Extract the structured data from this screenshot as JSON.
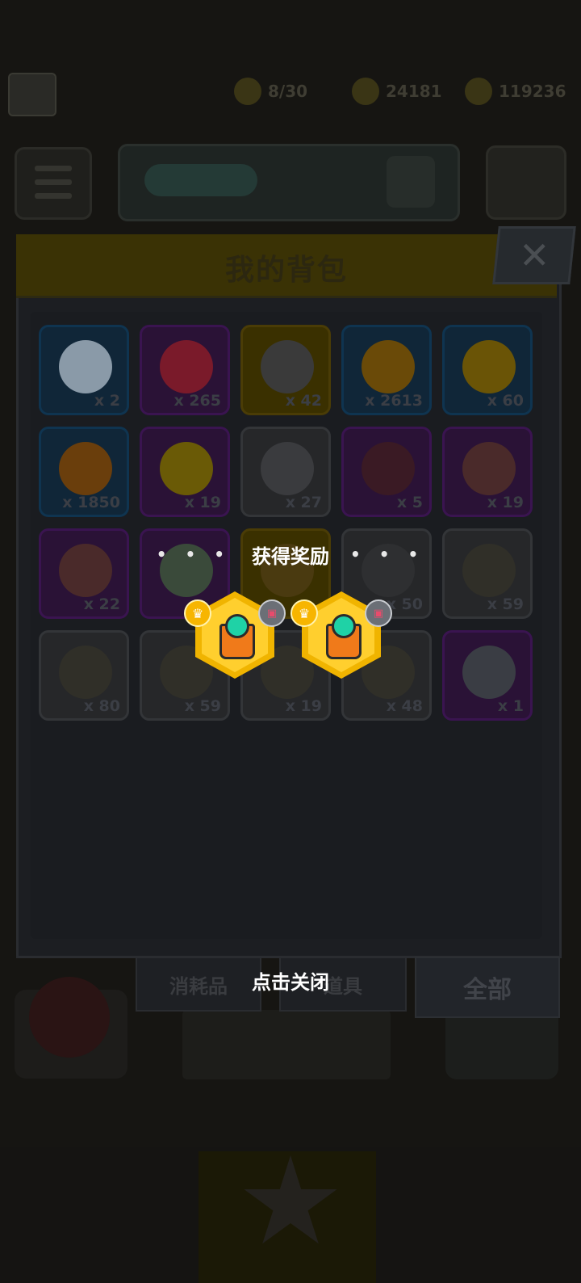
{
  "background": {
    "resources": [
      "8/30",
      "24181",
      "119236"
    ]
  },
  "backpack": {
    "title": "我的背包",
    "close_symbol": "✕",
    "items": [
      {
        "count": "x 2",
        "style": "blue",
        "icon": "key-icon",
        "color": "#8a9aa8"
      },
      {
        "count": "x 265",
        "style": "purple",
        "icon": "heart-coin-icon",
        "color": "#7a1a2a"
      },
      {
        "count": "x 42",
        "style": "gold",
        "icon": "square-key-icon",
        "color": "#3a3a3a"
      },
      {
        "count": "x 2613",
        "style": "blue",
        "icon": "flame-drop-icon",
        "color": "#6a4a08"
      },
      {
        "count": "x 60",
        "style": "blue",
        "icon": "gold-coin-icon",
        "color": "#6a5406"
      },
      {
        "count": "x 1850",
        "style": "blue",
        "icon": "lion-badge-icon",
        "color": "#6a3e0c"
      },
      {
        "count": "x 19",
        "style": "purple",
        "icon": "ticket-icon",
        "color": "#6a5a06"
      },
      {
        "count": "x 27",
        "style": "gray",
        "icon": "cube-icon",
        "color": "#3a3b3e"
      },
      {
        "count": "x 5",
        "style": "purple",
        "icon": "gem-ball-icon",
        "color": "#3a1a24"
      },
      {
        "count": "x 19",
        "style": "purple",
        "icon": "puzzle-piece-icon",
        "color": "#4a2a2a"
      },
      {
        "count": "x 22",
        "style": "purple",
        "icon": "puzzle-piece-icon",
        "color": "#4a2a2a"
      },
      {
        "count": "",
        "style": "purple",
        "icon": "puzzle-piece-icon",
        "color": "#3a4a3a"
      },
      {
        "count": "",
        "style": "gold",
        "icon": "chest-icon",
        "color": "#4a3a10"
      },
      {
        "count": "x 50",
        "style": "gray",
        "icon": "gun-blueprint-icon",
        "color": "#2e2f31"
      },
      {
        "count": "x 59",
        "style": "gray",
        "icon": "shirt-blueprint-icon",
        "color": "#302f28"
      },
      {
        "count": "x 80",
        "style": "gray",
        "icon": "collar-blueprint-icon",
        "color": "#302f28"
      },
      {
        "count": "x 59",
        "style": "gray",
        "icon": "belt-blueprint-icon",
        "color": "#302f28"
      },
      {
        "count": "x 19",
        "style": "gray",
        "icon": "glove-blueprint-icon",
        "color": "#302f28"
      },
      {
        "count": "x 48",
        "style": "gray",
        "icon": "pants-blueprint-icon",
        "color": "#302f28"
      },
      {
        "count": "x 1",
        "style": "purple",
        "icon": "s-chest-icon",
        "color": "#3a3d44"
      }
    ],
    "tabs": [
      "消耗品",
      "道具",
      "全部"
    ]
  },
  "reward_modal": {
    "dots": "• • •",
    "title": "获得奖励",
    "rewards": [
      {
        "icon": "turret-module-icon",
        "tier_badge": "crown-badge-icon",
        "type_badge": "device-badge-icon"
      },
      {
        "icon": "turret-module-icon",
        "tier_badge": "crown-badge-icon",
        "type_badge": "device-badge-icon"
      }
    ],
    "close_hint": "点击关闭"
  }
}
